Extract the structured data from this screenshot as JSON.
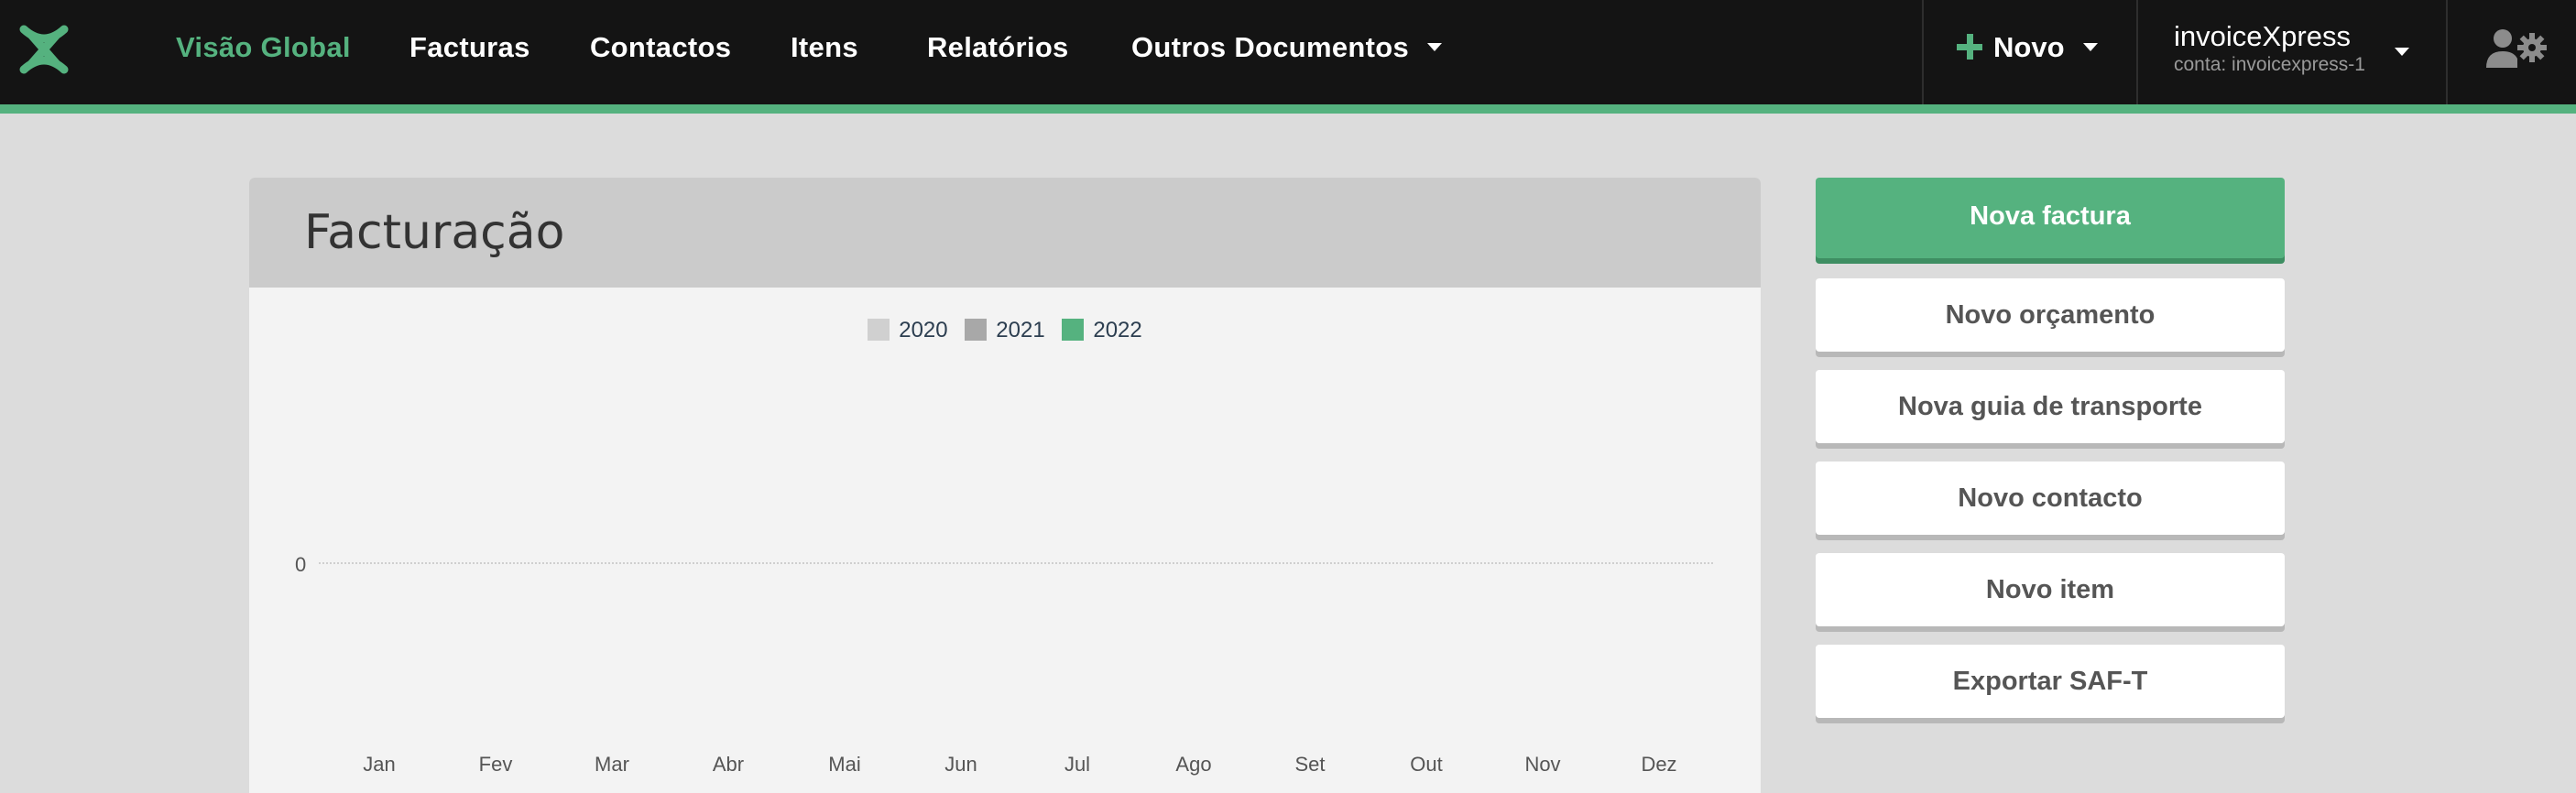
{
  "nav": {
    "logo": "x-logo-icon",
    "items": [
      {
        "label": "Visão Global",
        "active": true
      },
      {
        "label": "Facturas",
        "active": false
      },
      {
        "label": "Contactos",
        "active": false
      },
      {
        "label": "Itens",
        "active": false
      },
      {
        "label": "Relatórios",
        "active": false
      },
      {
        "label": "Outros Documentos",
        "active": false
      }
    ],
    "novo_label": "Novo",
    "account": {
      "name": "invoiceXpress",
      "sub": "conta: invoicexpress-1"
    }
  },
  "panel": {
    "title": "Facturação"
  },
  "chart_data": {
    "type": "bar",
    "title": "",
    "xlabel": "",
    "ylabel": "",
    "categories": [
      "Jan",
      "Fev",
      "Mar",
      "Abr",
      "Mai",
      "Jun",
      "Jul",
      "Ago",
      "Set",
      "Out",
      "Nov",
      "Dez"
    ],
    "series": [
      {
        "name": "2020",
        "color": "#d0d0d0",
        "values": [
          0,
          0,
          0,
          0,
          0,
          0,
          0,
          0,
          0,
          0,
          0,
          0
        ]
      },
      {
        "name": "2021",
        "color": "#a8a8a8",
        "values": [
          0,
          0,
          0,
          0,
          0,
          0,
          0,
          0,
          0,
          0,
          0,
          0
        ]
      },
      {
        "name": "2022",
        "color": "#55b27f",
        "values": [
          0,
          0,
          0,
          0,
          0,
          0,
          0,
          0,
          0,
          0,
          0,
          0
        ]
      }
    ],
    "y_ticks": [
      "0"
    ],
    "legend_position": "top-center"
  },
  "actions": {
    "nova_factura": "Nova factura",
    "novo_orcamento": "Novo orçamento",
    "nova_guia": "Nova guia de transporte",
    "novo_contacto": "Novo contacto",
    "novo_item": "Novo item",
    "exportar_saft": "Exportar SAF-T"
  },
  "colors": {
    "accent": "#55b27f",
    "topbar": "#141414",
    "background": "#dcdcdc"
  }
}
